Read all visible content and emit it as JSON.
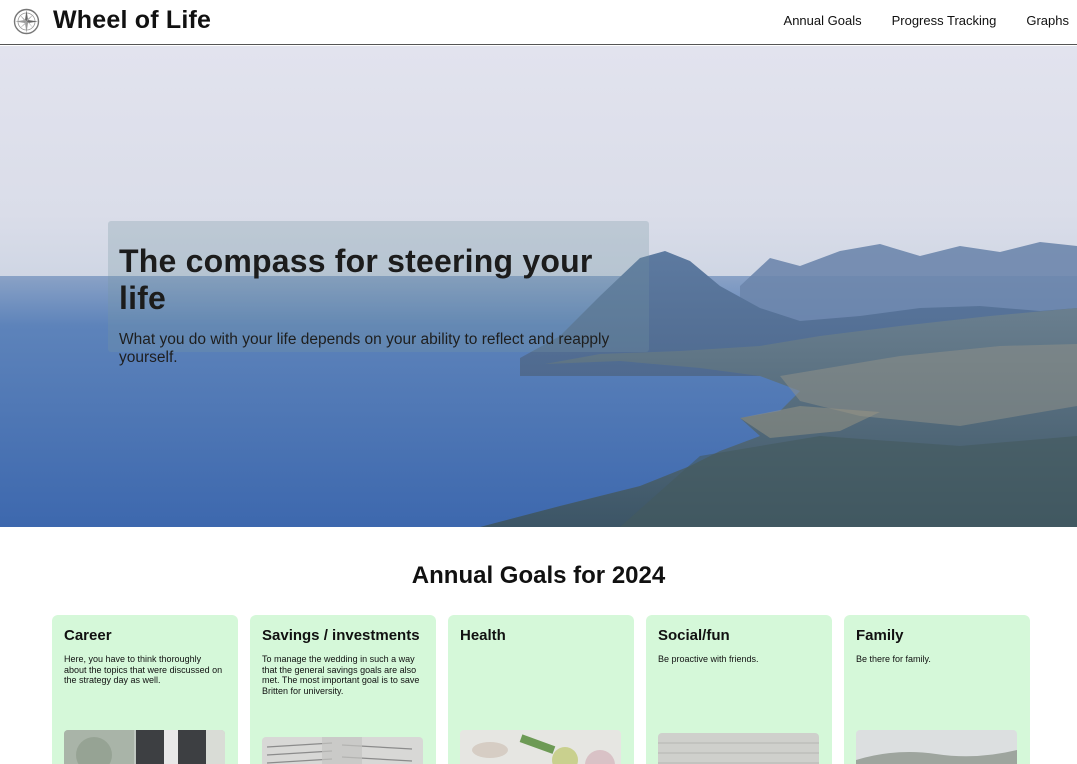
{
  "header": {
    "brand": "Wheel of Life",
    "nav": [
      "Annual Goals",
      "Progress Tracking",
      "Graphs"
    ]
  },
  "hero": {
    "title": "The compass for steering your life",
    "subtitle": "What you do with your life depends on your ability to reflect and reapply yourself."
  },
  "goals": {
    "heading": "Annual Goals for 2024",
    "cards": [
      {
        "title": "Career",
        "text": "Here, you have to think thoroughly about the topics that were discussed on the strategy day as well."
      },
      {
        "title": "Savings / investments",
        "text": "To manage the wedding in such a way that the general savings goals are also met. The most important goal is to save Britten for university."
      },
      {
        "title": "Health",
        "text": ""
      },
      {
        "title": "Social/fun",
        "text": "Be proactive with friends."
      },
      {
        "title": "Family",
        "text": "Be there for family."
      }
    ]
  },
  "colors": {
    "card_bg": "#d5f8d9",
    "header_border": "#555555"
  }
}
